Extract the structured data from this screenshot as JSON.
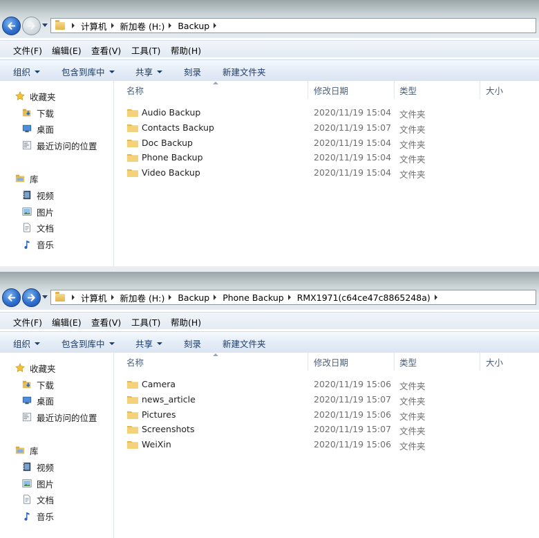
{
  "menu": [
    "文件(F)",
    "编辑(E)",
    "查看(V)",
    "工具(T)",
    "帮助(H)"
  ],
  "toolbar": {
    "organize": "组织",
    "include": "包含到库中",
    "share": "共享",
    "burn": "刻录",
    "new_folder": "新建文件夹"
  },
  "columns": {
    "name": "名称",
    "date": "修改日期",
    "type": "类型",
    "size": "大小"
  },
  "sidebar": {
    "favorites": "收藏夹",
    "downloads": "下载",
    "desktop": "桌面",
    "recent": "最近访问的位置",
    "libraries": "库",
    "videos": "视频",
    "pictures": "图片",
    "documents": "文档",
    "music": "音乐"
  },
  "windows": [
    {
      "path": [
        "计算机",
        "新加卷 (H:)",
        "Backup"
      ],
      "files": [
        {
          "name": "Audio Backup",
          "date": "2020/11/19 15:04",
          "type": "文件夹"
        },
        {
          "name": "Contacts Backup",
          "date": "2020/11/19 15:07",
          "type": "文件夹"
        },
        {
          "name": "Doc Backup",
          "date": "2020/11/19 15:04",
          "type": "文件夹"
        },
        {
          "name": "Phone Backup",
          "date": "2020/11/19 15:04",
          "type": "文件夹"
        },
        {
          "name": "Video Backup",
          "date": "2020/11/19 15:04",
          "type": "文件夹"
        }
      ]
    },
    {
      "path": [
        "计算机",
        "新加卷 (H:)",
        "Backup",
        "Phone Backup",
        "RMX1971(c64ce47c8865248a)"
      ],
      "files": [
        {
          "name": "Camera",
          "date": "2020/11/19 15:06",
          "type": "文件夹"
        },
        {
          "name": "news_article",
          "date": "2020/11/19 15:07",
          "type": "文件夹"
        },
        {
          "name": "Pictures",
          "date": "2020/11/19 15:06",
          "type": "文件夹"
        },
        {
          "name": "Screenshots",
          "date": "2020/11/19 15:07",
          "type": "文件夹"
        },
        {
          "name": "WeiXin",
          "date": "2020/11/19 15:06",
          "type": "文件夹"
        }
      ]
    }
  ]
}
